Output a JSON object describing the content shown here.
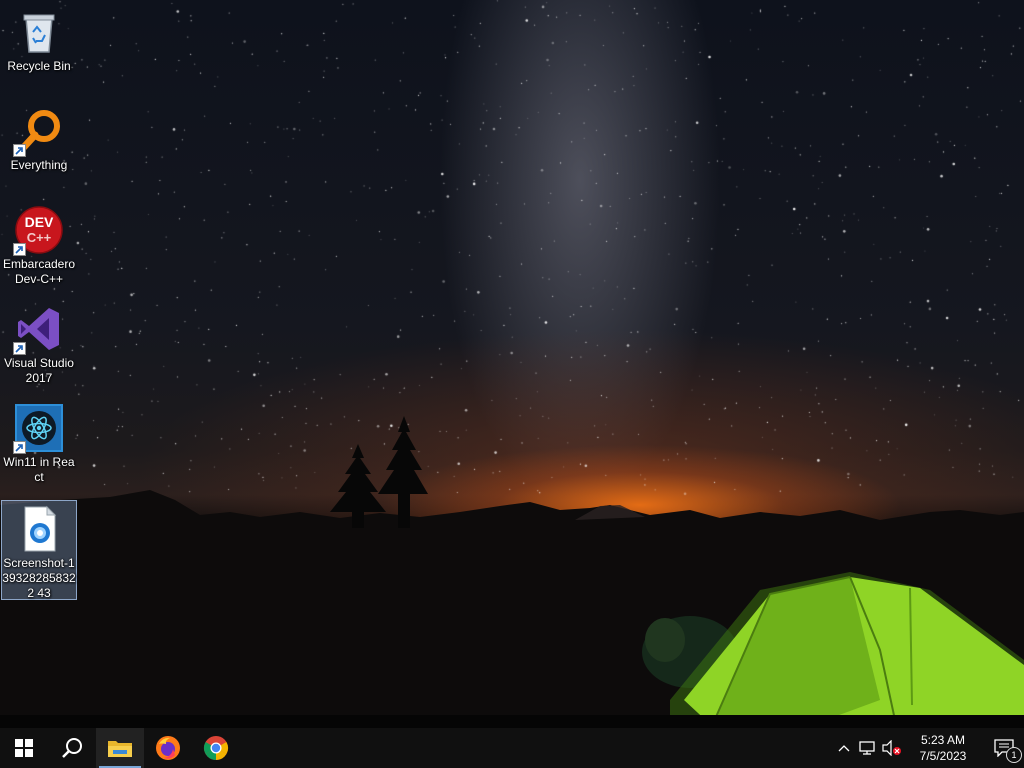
{
  "desktop": {
    "icons": [
      {
        "label": "Recycle Bin",
        "icon": "recycle-bin-icon"
      },
      {
        "label": "Everything",
        "icon": "everything-search-icon"
      },
      {
        "label": "Embarcadero Dev-C++",
        "icon": "dev-cpp-icon",
        "art_text": "DEV C++"
      },
      {
        "label": "Visual Studio 2017",
        "icon": "visual-studio-icon"
      },
      {
        "label": "Win11 in React",
        "icon": "react-app-icon"
      },
      {
        "label": "Screenshot-1393282858322 43",
        "icon": "image-file-icon",
        "selected": true
      }
    ]
  },
  "taskbar": {
    "buttons": [
      {
        "name": "start",
        "icon": "windows-logo-icon"
      },
      {
        "name": "search",
        "icon": "search-icon"
      },
      {
        "name": "file-explorer",
        "icon": "folder-icon",
        "active": true
      },
      {
        "name": "firefox",
        "icon": "firefox-icon"
      },
      {
        "name": "chrome",
        "icon": "chrome-icon"
      }
    ],
    "tray": {
      "icons": [
        "chevron-up-icon",
        "network-icon",
        "volume-muted-icon"
      ],
      "time": "5:23 AM",
      "date": "7/5/2023",
      "notification_count": "1"
    }
  },
  "colors": {
    "taskbar": "#101010",
    "active_indicator": "#7aa7d8",
    "selection": "#8caad2"
  }
}
